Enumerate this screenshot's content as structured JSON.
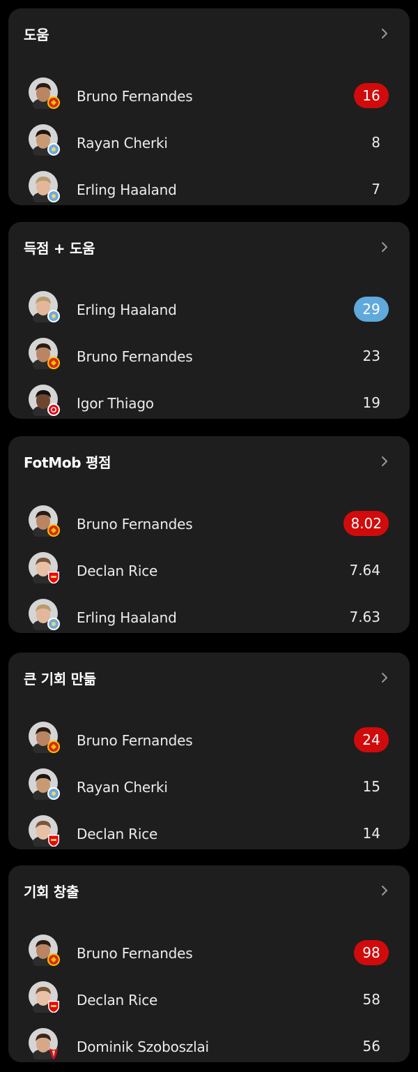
{
  "colors": {
    "card_bg": "#1e1e1e",
    "highlight_red": "#d10b0b",
    "highlight_blue": "#5fa9dc",
    "man_utd": "#da291c",
    "man_city": "#6cabdd",
    "arsenal": "#ef0107",
    "brentford": "#e30613",
    "liverpool": "#c8102e"
  },
  "sections": [
    {
      "title": "도움",
      "rows": [
        {
          "name": "Bruno Fernandes",
          "value": "16",
          "highlight": "red",
          "team": "man-utd",
          "skin": "#b98563",
          "hair": "#2a1c14"
        },
        {
          "name": "Rayan Cherki",
          "value": "8",
          "highlight": "",
          "team": "man-city",
          "skin": "#c89a74",
          "hair": "#1d1510"
        },
        {
          "name": "Erling Haaland",
          "value": "7",
          "highlight": "",
          "team": "man-city",
          "skin": "#e2b79a",
          "hair": "#b89b6e"
        }
      ]
    },
    {
      "title": "득점 + 도움",
      "rows": [
        {
          "name": "Erling Haaland",
          "value": "29",
          "highlight": "blue",
          "team": "man-city",
          "skin": "#e2b79a",
          "hair": "#b89b6e"
        },
        {
          "name": "Bruno Fernandes",
          "value": "23",
          "highlight": "",
          "team": "man-utd",
          "skin": "#b98563",
          "hair": "#2a1c14"
        },
        {
          "name": "Igor Thiago",
          "value": "19",
          "highlight": "",
          "team": "brentford",
          "skin": "#6e4630",
          "hair": "#161110"
        }
      ]
    },
    {
      "title": "FotMob 평점",
      "rows": [
        {
          "name": "Bruno Fernandes",
          "value": "8.02",
          "highlight": "red",
          "team": "man-utd",
          "skin": "#b98563",
          "hair": "#2a1c14"
        },
        {
          "name": "Declan Rice",
          "value": "7.64",
          "highlight": "",
          "team": "arsenal",
          "skin": "#e8c0a6",
          "hair": "#7a5638"
        },
        {
          "name": "Erling Haaland",
          "value": "7.63",
          "highlight": "",
          "team": "man-city",
          "skin": "#e2b79a",
          "hair": "#b89b6e"
        }
      ]
    },
    {
      "title": "큰 기회 만듦",
      "rows": [
        {
          "name": "Bruno Fernandes",
          "value": "24",
          "highlight": "red",
          "team": "man-utd",
          "skin": "#b98563",
          "hair": "#2a1c14"
        },
        {
          "name": "Rayan Cherki",
          "value": "15",
          "highlight": "",
          "team": "man-city",
          "skin": "#c89a74",
          "hair": "#1d1510"
        },
        {
          "name": "Declan Rice",
          "value": "14",
          "highlight": "",
          "team": "arsenal",
          "skin": "#e8c0a6",
          "hair": "#7a5638"
        }
      ]
    },
    {
      "title": "기회 창출",
      "rows": [
        {
          "name": "Bruno Fernandes",
          "value": "98",
          "highlight": "red",
          "team": "man-utd",
          "skin": "#b98563",
          "hair": "#2a1c14"
        },
        {
          "name": "Declan Rice",
          "value": "58",
          "highlight": "",
          "team": "arsenal",
          "skin": "#e8c0a6",
          "hair": "#7a5638"
        },
        {
          "name": "Dominik Szoboszlai",
          "value": "56",
          "highlight": "",
          "team": "liverpool",
          "skin": "#d7a888",
          "hair": "#3b2619"
        }
      ]
    }
  ]
}
